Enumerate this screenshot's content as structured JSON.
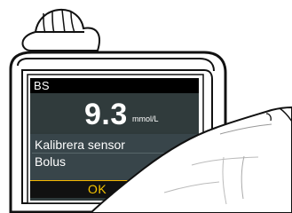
{
  "screen": {
    "title": "BS",
    "glucose_value": "9.3",
    "glucose_unit": "mmol/L",
    "menu_items": [
      {
        "label": "Kalibrera sensor"
      },
      {
        "label": "Bolus"
      }
    ],
    "ok_label": "OK"
  },
  "colors": {
    "title_bar": "#000000",
    "screen_background": "#2f3a3b",
    "menu_background": "#38454a",
    "ok_text": "#f6c400",
    "ok_border": "#f5b700"
  },
  "icons": {
    "device_clip": "device-clip-icon",
    "hand": "hand-icon"
  }
}
